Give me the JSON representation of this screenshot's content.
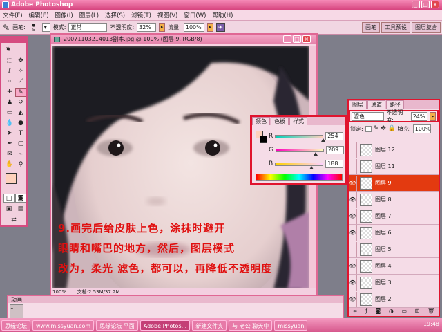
{
  "window": {
    "title": "Adobe Photoshop"
  },
  "menu": [
    "文件(F)",
    "编辑(E)",
    "图像(I)",
    "图层(L)",
    "选择(S)",
    "滤镜(T)",
    "视图(V)",
    "窗口(W)",
    "帮助(H)"
  ],
  "options": {
    "brush_label": "画笔:",
    "brush_size": "5",
    "mode_label": "模式:",
    "mode_value": "正常",
    "opacity_label": "不透明度:",
    "opacity_value": "32%",
    "flow_label": "流量:",
    "flow_value": "100%",
    "wells": [
      "画笔",
      "工具预设",
      "图层复合"
    ]
  },
  "document": {
    "title": "20071103214013副本.jpg @ 100% (图层 9, RGB/8)",
    "zoom": "100%",
    "status": "文档:2.53M/37.2M"
  },
  "color_panel": {
    "tabs": [
      "颜色",
      "色板",
      "样式"
    ],
    "channels": [
      {
        "name": "R",
        "value": "254",
        "fraction": 0.996,
        "gradient": "linear-gradient(90deg,#00d1bc,#fed1bc)"
      },
      {
        "name": "G",
        "value": "209",
        "fraction": 0.82,
        "gradient": "linear-gradient(90deg,#fe00bc,#feffbc)"
      },
      {
        "name": "B",
        "value": "188",
        "fraction": 0.737,
        "gradient": "linear-gradient(90deg,#fed100,#fed1ff)"
      }
    ],
    "fg_color": "#fed1bc",
    "bg_color": "#000000"
  },
  "layers_panel": {
    "tabs": [
      "图层",
      "通道",
      "路径"
    ],
    "blend_mode": "滤色",
    "opacity_label": "不透明度:",
    "opacity_value": "24%",
    "lock_label": "锁定:",
    "fill_label": "填充:",
    "fill_value": "100%",
    "layers": [
      {
        "name": "图层 12",
        "visible": false,
        "selected": false
      },
      {
        "name": "图层 11",
        "visible": false,
        "selected": false
      },
      {
        "name": "图层 9",
        "visible": true,
        "selected": true
      },
      {
        "name": "图层 8",
        "visible": true,
        "selected": false
      },
      {
        "name": "图层 7",
        "visible": true,
        "selected": false
      },
      {
        "name": "图层 6",
        "visible": true,
        "selected": false
      },
      {
        "name": "图层 5",
        "visible": false,
        "selected": false
      },
      {
        "name": "图层 4",
        "visible": true,
        "selected": false
      },
      {
        "name": "图层 3",
        "visible": true,
        "selected": false
      },
      {
        "name": "图层 2",
        "visible": true,
        "selected": false
      }
    ]
  },
  "animation_panel": {
    "tab": "动画",
    "frame_number": "1"
  },
  "annotation": [
    "9.画完后给皮肤上色，涂抹时避开",
    "眼睛和嘴巴的地方，然后，图层模式",
    "改为，柔光 滤色，都可以，再降低不透明度"
  ],
  "taskbar": {
    "items": [
      "思缘论坛",
      "www.missyuan.com",
      "思缘论坛 平面",
      "Adobe Photos...",
      "新建文件夹",
      "与 老公 聊天中",
      "missyuan"
    ],
    "clock": "19:48"
  }
}
